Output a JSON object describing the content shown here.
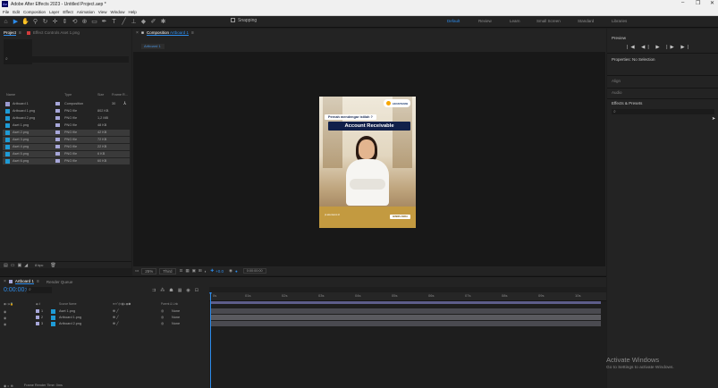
{
  "window": {
    "title": "Adobe After Effects 2023 - Untitled Project.aep *",
    "controls": [
      "–",
      "❐",
      "✕"
    ]
  },
  "menu": [
    "File",
    "Edit",
    "Composition",
    "Layer",
    "Effect",
    "Animation",
    "View",
    "Window",
    "Help"
  ],
  "toolbar": {
    "snapping_label": "Snapping",
    "workspaces": [
      "Default",
      "Review",
      "Learn",
      "Small Screen",
      "Standard",
      "Libraries"
    ]
  },
  "project": {
    "tab_label": "Project",
    "effect_controls_label": "Effect Controls Aset 1.png",
    "columns": {
      "name": "Name",
      "type": "Type",
      "size": "Size",
      "frame_rate": "Frame R..."
    },
    "items": [
      {
        "name": "Artboard 1",
        "type": "Composition",
        "size": "",
        "fps": "30",
        "color": "#a7a7d9",
        "icon": "composition-icon"
      },
      {
        "name": "Artboard 1.png",
        "type": "PNG file",
        "size": "802 KB",
        "color": "#a7a7d9",
        "icon": "image-icon"
      },
      {
        "name": "Artboard 2.png",
        "type": "PNG file",
        "size": "1,2 MB",
        "color": "#a7a7d9",
        "icon": "image-icon"
      },
      {
        "name": "Aset 1.png",
        "type": "PNG file",
        "size": "48 KB",
        "color": "#a7a7d9",
        "icon": "image-icon"
      },
      {
        "name": "Aset 2.png",
        "type": "PNG file",
        "size": "42 KB",
        "color": "#a7a7d9",
        "icon": "image-icon"
      },
      {
        "name": "Aset 3.png",
        "type": "PNG file",
        "size": "72 KB",
        "color": "#a7a7d9",
        "icon": "image-icon"
      },
      {
        "name": "Aset 4.png",
        "type": "PNG file",
        "size": "22 KB",
        "color": "#a7a7d9",
        "icon": "image-icon"
      },
      {
        "name": "Aset 5.png",
        "type": "PNG file",
        "size": "6 KB",
        "color": "#a7a7d9",
        "icon": "image-icon"
      },
      {
        "name": "Aset 6.png",
        "type": "PNG file",
        "size": "60 KB",
        "color": "#a7a7d9",
        "icon": "image-icon"
      }
    ],
    "bpc": "8 bpc"
  },
  "composition": {
    "tab_label": "Composition",
    "comp_name": "Artboard 1",
    "breadcrumb": "Artboard 1",
    "zoom": "25%",
    "resolution": "Third",
    "exposure": "+0.0",
    "timecode": "0:00:00:00"
  },
  "artboard": {
    "question": "Pernah mendengar istilah ?",
    "title": "Account Receivable",
    "brand": "AKUNTANSI",
    "footer_left": "pt.akuntansi.id",
    "footer_right": "BISNIS ANDA"
  },
  "right_panel": {
    "preview": "Preview",
    "preview_controls": "|◀ ◀| ▶ |▶ ▶|",
    "properties": "Properties: No Selection",
    "align": "Align",
    "audio": "Audio",
    "effects": "Effects & Presets",
    "activate_title": "Activate Windows",
    "activate_sub": "Go to Settings to activate Windows."
  },
  "timeline": {
    "comp_tab": "Artboard 1",
    "render_queue": "Render Queue",
    "timecode": "0:00:00:00",
    "columns": {
      "source_name": "Source Name",
      "parent": "Parent & Link"
    },
    "layers": [
      {
        "num": "1",
        "name": "Aset 1.png",
        "mode": "None",
        "color": "#a7a7d9"
      },
      {
        "num": "2",
        "name": "Artboard 1.png",
        "mode": "None",
        "color": "#a7a7d9"
      },
      {
        "num": "3",
        "name": "Artboard 2.png",
        "mode": "None",
        "color": "#a7a7d9"
      }
    ],
    "ticks": [
      "0s",
      "01s",
      "02s",
      "03s",
      "04s",
      "05s",
      "06s",
      "07s",
      "08s",
      "09s",
      "10s"
    ],
    "bottom": "Frame Render Time: 0ms"
  }
}
